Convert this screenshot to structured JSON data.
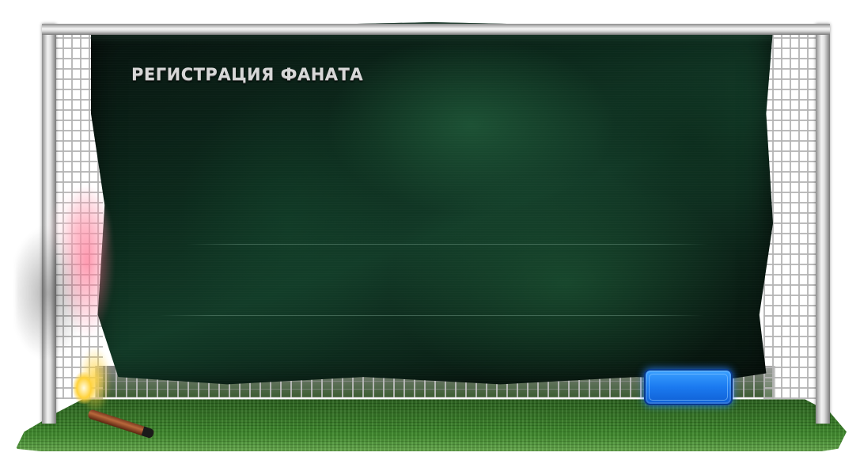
{
  "form": {
    "title": "РЕГИСТРАЦИЯ ФАНАТА",
    "submit_label": ""
  },
  "colors": {
    "banner": "#0c2a1c",
    "button": "#1b7af0",
    "title_text": "#d7d7d7"
  }
}
